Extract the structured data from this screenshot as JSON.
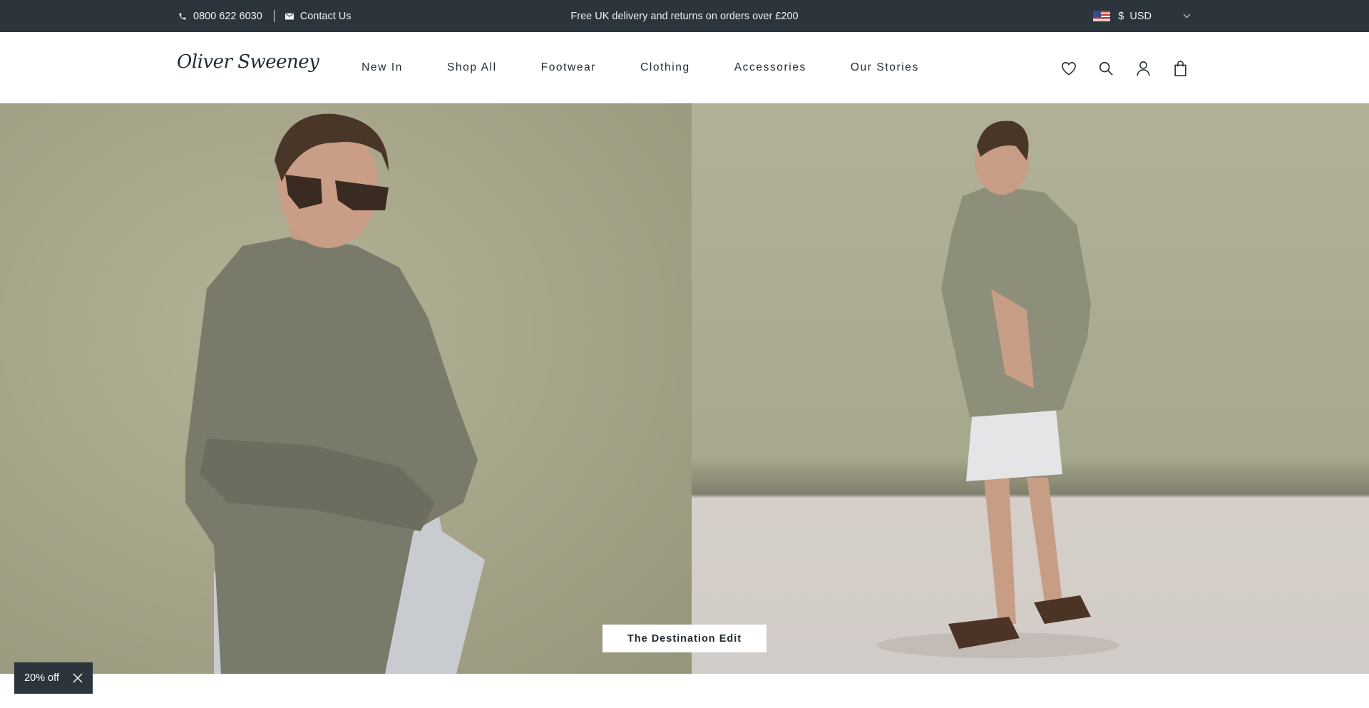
{
  "topbar": {
    "phone": "0800 622 6030",
    "contact": "Contact Us",
    "promo": "Free UK delivery and returns on orders over £200",
    "currency_symbol": "$",
    "currency": "USD"
  },
  "header": {
    "logo": "Oliver Sweeney",
    "nav": [
      "New In",
      "Shop All",
      "Footwear",
      "Clothing",
      "Accessories",
      "Our Stories"
    ],
    "icons": [
      "wishlist-heart-icon",
      "search-icon",
      "account-icon",
      "bag-icon"
    ]
  },
  "hero": {
    "cta": "The Destination Edit"
  },
  "discount": {
    "label": "20% off"
  },
  "colors": {
    "topbar_bg": "#2b353b",
    "text": "#1f2a30",
    "hero_left": "#a7a68b",
    "hero_floor": "#d2ccc8"
  }
}
